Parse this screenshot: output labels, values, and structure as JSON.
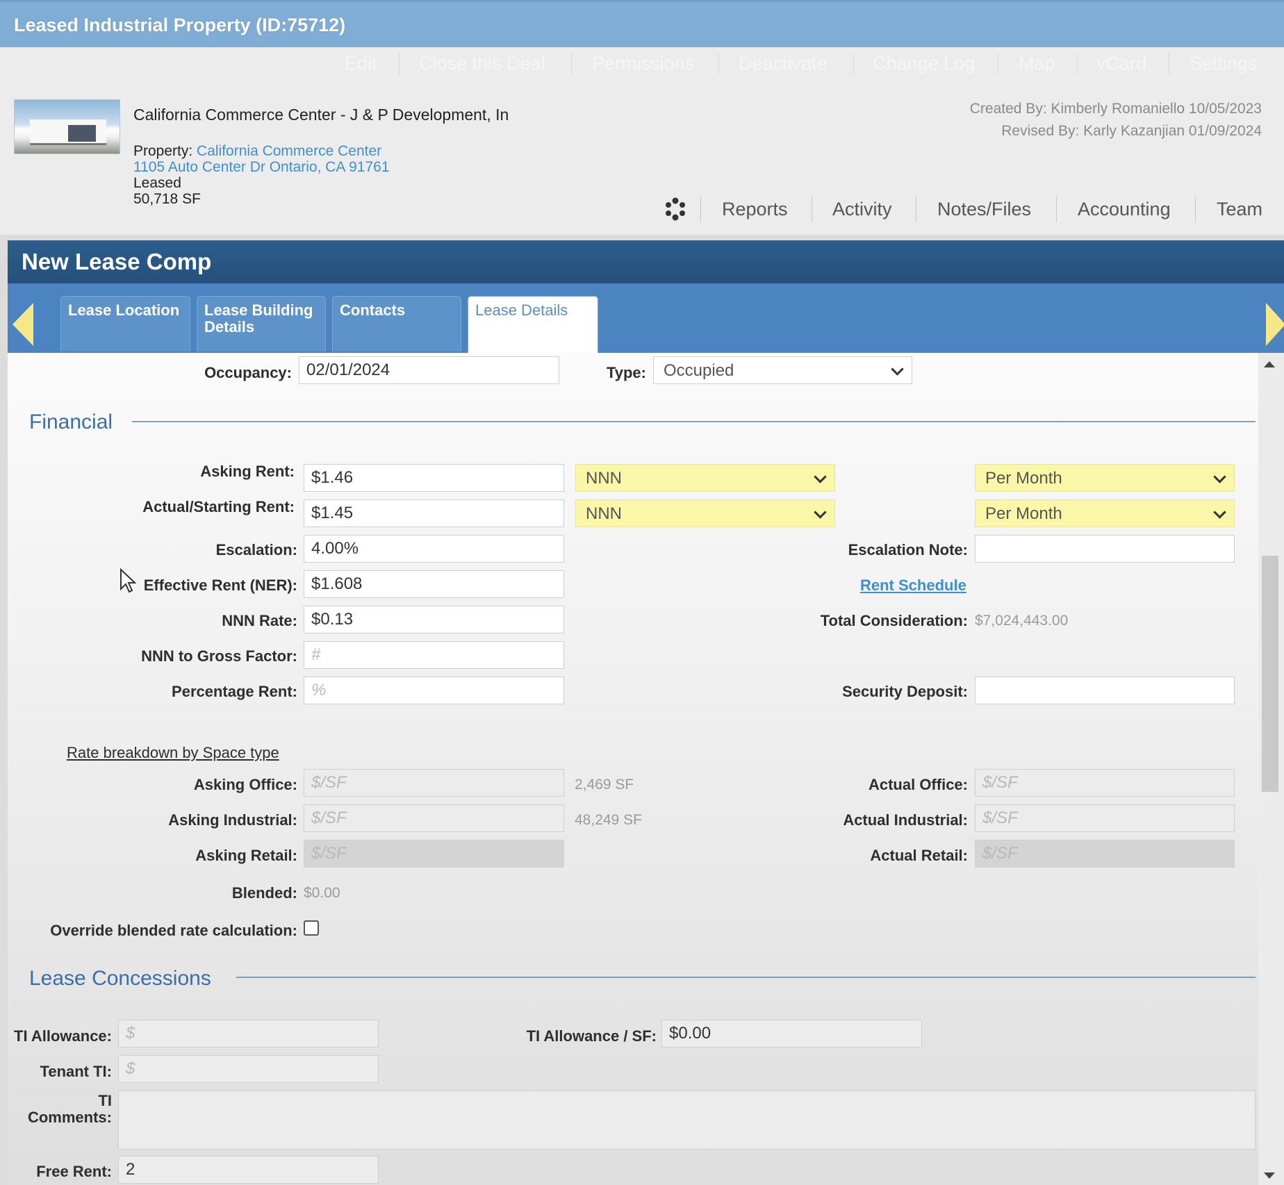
{
  "window": {
    "title": "Leased Industrial Property (ID:75712)",
    "menu": [
      "Edit",
      "Close this Deal",
      "Permissions",
      "Deactivate",
      "Change Log",
      "Map",
      "vCard",
      "Settings"
    ]
  },
  "header": {
    "deal_name": "California Commerce Center - J & P Development, In",
    "property_label": "Property:",
    "property_name": "California Commerce Center",
    "address": "1105 Auto Center Dr Ontario, CA 91761",
    "status": "Leased",
    "size": "50,718 SF",
    "created_by": "Created By: Kimberly Romaniello 10/05/2023",
    "revised_by": "Revised By: Karly Kazanjian 01/09/2024",
    "nav": [
      "Reports",
      "Activity",
      "Notes/Files",
      "Accounting",
      "Team"
    ]
  },
  "dialog": {
    "title": "New Lease Comp",
    "tabs": [
      {
        "label": "Lease Location"
      },
      {
        "label": "Lease Building Details"
      },
      {
        "label": "Contacts"
      },
      {
        "label": "Lease Details",
        "active": true
      }
    ]
  },
  "form": {
    "occupancy_label": "Occupancy:",
    "occupancy_value": "02/01/2024",
    "type_label": "Type:",
    "type_value": "Occupied",
    "financial_title": "Financial",
    "asking_rent_label": "Asking Rent:",
    "asking_rent_value": "$1.46",
    "asking_rent_type": "NNN",
    "asking_rent_period": "Per Month",
    "actual_rent_label": "Actual/Starting Rent:",
    "actual_rent_value": "$1.45",
    "actual_rent_type": "NNN",
    "actual_rent_period": "Per Month",
    "escalation_label": "Escalation:",
    "escalation_value": "4.00%",
    "escalation_note_label": "Escalation Note:",
    "effective_rent_label": "Effective Rent (NER):",
    "effective_rent_value": "$1.608",
    "rent_schedule_link": "Rent Schedule",
    "nnn_rate_label": "NNN Rate:",
    "nnn_rate_value": "$0.13",
    "total_consideration_label": "Total Consideration:",
    "total_consideration_value": "$7,024,443.00",
    "nnn_gross_label": "NNN to Gross Factor:",
    "nnn_gross_placeholder": "#",
    "percentage_rent_label": "Percentage Rent:",
    "percentage_rent_placeholder": "%",
    "security_deposit_label": "Security Deposit:",
    "rate_breakdown_link": "Rate breakdown by Space type",
    "asking_office_label": "Asking Office:",
    "asking_industrial_label": "Asking Industrial:",
    "asking_retail_label": "Asking Retail:",
    "actual_office_label": "Actual Office:",
    "actual_industrial_label": "Actual Industrial:",
    "actual_retail_label": "Actual Retail:",
    "psf_placeholder": "$/SF",
    "office_sf": "2,469 SF",
    "industrial_sf": "48,249 SF",
    "blended_label": "Blended:",
    "blended_value": "$0.00",
    "override_label": "Override blended rate calculation:",
    "concessions_title": "Lease Concessions",
    "ti_allowance_label": "TI Allowance:",
    "ti_allowance_sf_label": "TI Allowance / SF:",
    "ti_allowance_sf_value": "$0.00",
    "tenant_ti_label": "Tenant TI:",
    "dollar_placeholder": "$",
    "ti_comments_label_1": "TI",
    "ti_comments_label_2": "Comments:",
    "free_rent_label": "Free Rent:",
    "free_rent_value": "2"
  }
}
